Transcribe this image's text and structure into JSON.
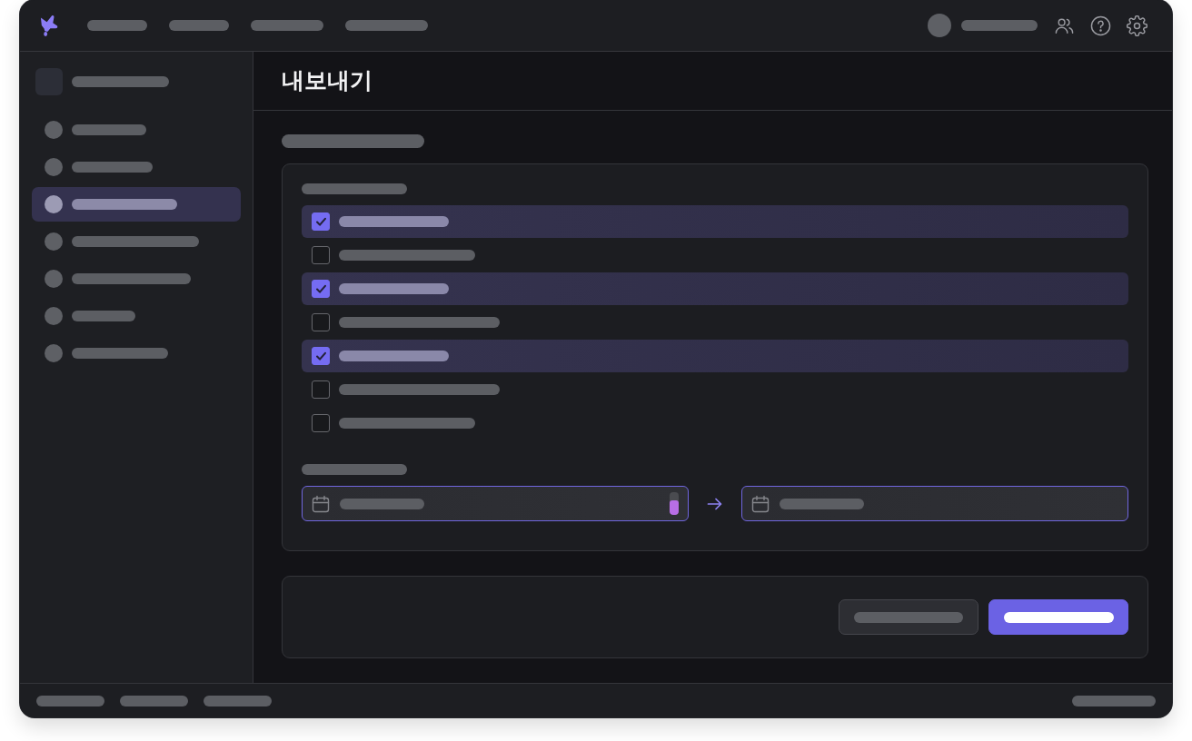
{
  "sidebar": {
    "items": [
      {
        "selected": false
      },
      {
        "selected": false
      },
      {
        "selected": true
      },
      {
        "selected": false
      },
      {
        "selected": false
      },
      {
        "selected": false
      },
      {
        "selected": false
      }
    ]
  },
  "page": {
    "title": "내보내기"
  },
  "export_options": [
    {
      "checked": true
    },
    {
      "checked": false
    },
    {
      "checked": true
    },
    {
      "checked": false
    },
    {
      "checked": true
    },
    {
      "checked": false
    },
    {
      "checked": false
    }
  ],
  "date_range": {
    "start_meter": {
      "level": 0.65
    }
  }
}
